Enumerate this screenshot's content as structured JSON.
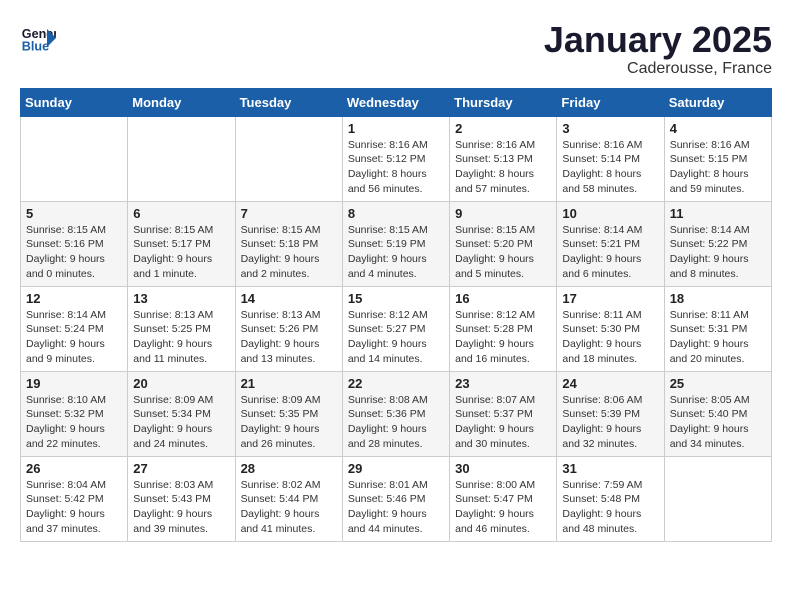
{
  "header": {
    "logo_line1": "General",
    "logo_line2": "Blue",
    "month": "January 2025",
    "location": "Caderousse, France"
  },
  "weekdays": [
    "Sunday",
    "Monday",
    "Tuesday",
    "Wednesday",
    "Thursday",
    "Friday",
    "Saturday"
  ],
  "weeks": [
    [
      {
        "day": "",
        "text": ""
      },
      {
        "day": "",
        "text": ""
      },
      {
        "day": "",
        "text": ""
      },
      {
        "day": "1",
        "text": "Sunrise: 8:16 AM\nSunset: 5:12 PM\nDaylight: 8 hours and 56 minutes."
      },
      {
        "day": "2",
        "text": "Sunrise: 8:16 AM\nSunset: 5:13 PM\nDaylight: 8 hours and 57 minutes."
      },
      {
        "day": "3",
        "text": "Sunrise: 8:16 AM\nSunset: 5:14 PM\nDaylight: 8 hours and 58 minutes."
      },
      {
        "day": "4",
        "text": "Sunrise: 8:16 AM\nSunset: 5:15 PM\nDaylight: 8 hours and 59 minutes."
      }
    ],
    [
      {
        "day": "5",
        "text": "Sunrise: 8:15 AM\nSunset: 5:16 PM\nDaylight: 9 hours and 0 minutes."
      },
      {
        "day": "6",
        "text": "Sunrise: 8:15 AM\nSunset: 5:17 PM\nDaylight: 9 hours and 1 minute."
      },
      {
        "day": "7",
        "text": "Sunrise: 8:15 AM\nSunset: 5:18 PM\nDaylight: 9 hours and 2 minutes."
      },
      {
        "day": "8",
        "text": "Sunrise: 8:15 AM\nSunset: 5:19 PM\nDaylight: 9 hours and 4 minutes."
      },
      {
        "day": "9",
        "text": "Sunrise: 8:15 AM\nSunset: 5:20 PM\nDaylight: 9 hours and 5 minutes."
      },
      {
        "day": "10",
        "text": "Sunrise: 8:14 AM\nSunset: 5:21 PM\nDaylight: 9 hours and 6 minutes."
      },
      {
        "day": "11",
        "text": "Sunrise: 8:14 AM\nSunset: 5:22 PM\nDaylight: 9 hours and 8 minutes."
      }
    ],
    [
      {
        "day": "12",
        "text": "Sunrise: 8:14 AM\nSunset: 5:24 PM\nDaylight: 9 hours and 9 minutes."
      },
      {
        "day": "13",
        "text": "Sunrise: 8:13 AM\nSunset: 5:25 PM\nDaylight: 9 hours and 11 minutes."
      },
      {
        "day": "14",
        "text": "Sunrise: 8:13 AM\nSunset: 5:26 PM\nDaylight: 9 hours and 13 minutes."
      },
      {
        "day": "15",
        "text": "Sunrise: 8:12 AM\nSunset: 5:27 PM\nDaylight: 9 hours and 14 minutes."
      },
      {
        "day": "16",
        "text": "Sunrise: 8:12 AM\nSunset: 5:28 PM\nDaylight: 9 hours and 16 minutes."
      },
      {
        "day": "17",
        "text": "Sunrise: 8:11 AM\nSunset: 5:30 PM\nDaylight: 9 hours and 18 minutes."
      },
      {
        "day": "18",
        "text": "Sunrise: 8:11 AM\nSunset: 5:31 PM\nDaylight: 9 hours and 20 minutes."
      }
    ],
    [
      {
        "day": "19",
        "text": "Sunrise: 8:10 AM\nSunset: 5:32 PM\nDaylight: 9 hours and 22 minutes."
      },
      {
        "day": "20",
        "text": "Sunrise: 8:09 AM\nSunset: 5:34 PM\nDaylight: 9 hours and 24 minutes."
      },
      {
        "day": "21",
        "text": "Sunrise: 8:09 AM\nSunset: 5:35 PM\nDaylight: 9 hours and 26 minutes."
      },
      {
        "day": "22",
        "text": "Sunrise: 8:08 AM\nSunset: 5:36 PM\nDaylight: 9 hours and 28 minutes."
      },
      {
        "day": "23",
        "text": "Sunrise: 8:07 AM\nSunset: 5:37 PM\nDaylight: 9 hours and 30 minutes."
      },
      {
        "day": "24",
        "text": "Sunrise: 8:06 AM\nSunset: 5:39 PM\nDaylight: 9 hours and 32 minutes."
      },
      {
        "day": "25",
        "text": "Sunrise: 8:05 AM\nSunset: 5:40 PM\nDaylight: 9 hours and 34 minutes."
      }
    ],
    [
      {
        "day": "26",
        "text": "Sunrise: 8:04 AM\nSunset: 5:42 PM\nDaylight: 9 hours and 37 minutes."
      },
      {
        "day": "27",
        "text": "Sunrise: 8:03 AM\nSunset: 5:43 PM\nDaylight: 9 hours and 39 minutes."
      },
      {
        "day": "28",
        "text": "Sunrise: 8:02 AM\nSunset: 5:44 PM\nDaylight: 9 hours and 41 minutes."
      },
      {
        "day": "29",
        "text": "Sunrise: 8:01 AM\nSunset: 5:46 PM\nDaylight: 9 hours and 44 minutes."
      },
      {
        "day": "30",
        "text": "Sunrise: 8:00 AM\nSunset: 5:47 PM\nDaylight: 9 hours and 46 minutes."
      },
      {
        "day": "31",
        "text": "Sunrise: 7:59 AM\nSunset: 5:48 PM\nDaylight: 9 hours and 48 minutes."
      },
      {
        "day": "",
        "text": ""
      }
    ]
  ]
}
